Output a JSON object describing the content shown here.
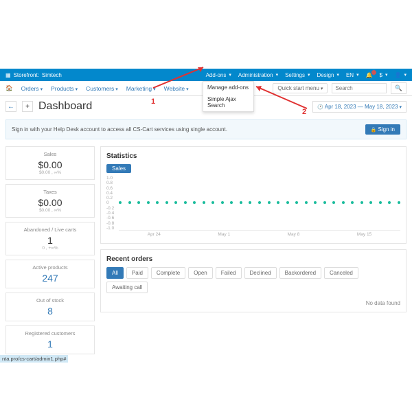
{
  "topbar": {
    "storefront_label": "Storefront:",
    "storefront_name": "Simtech",
    "menu": {
      "addons": "Add-ons",
      "administration": "Administration",
      "settings": "Settings",
      "design": "Design",
      "lang": "EN",
      "currency": "$"
    }
  },
  "nav": {
    "orders": "Orders",
    "products": "Products",
    "customers": "Customers",
    "marketing": "Marketing",
    "website": "Website",
    "quickstart": "Quick start menu",
    "search_placeholder": "Search"
  },
  "dropdown": {
    "manage": "Manage add-ons",
    "ajax": "Simple Ajax Search"
  },
  "page": {
    "title": "Dashboard",
    "date_range": "Apr 18, 2023 — May 18, 2023",
    "notice": "Sign in with your Help Desk account to access all CS-Cart services using single account.",
    "signin": "Sign in"
  },
  "annotations": {
    "a1": "1",
    "a2": "2"
  },
  "stats": [
    {
      "label": "Sales",
      "value": "$0.00",
      "sub": "$0.00 , ∞%",
      "blue": false
    },
    {
      "label": "Taxes",
      "value": "$0.00",
      "sub": "$0.00 , ∞%",
      "blue": false
    },
    {
      "label": "Abandoned / Live carts",
      "value": "1",
      "sub": "0 , +∞%",
      "blue": false
    },
    {
      "label": "Active products",
      "value": "247",
      "sub": "",
      "blue": true
    },
    {
      "label": "Out of stock",
      "value": "8",
      "sub": "",
      "blue": true
    },
    {
      "label": "Registered customers",
      "value": "1",
      "sub": "",
      "blue": true
    }
  ],
  "statistics": {
    "title": "Statistics",
    "tab": "Sales"
  },
  "chart_data": {
    "type": "line",
    "title": "Sales",
    "ylim": [
      -1.0,
      1.0
    ],
    "yticks": [
      "1.0",
      "0.8",
      "0.6",
      "0.4",
      "0.2",
      "0",
      "-0.2",
      "-0.4",
      "-0.6",
      "-0.8",
      "-1.0"
    ],
    "xticks": [
      "Apr 24",
      "May 1",
      "May 8",
      "May 15"
    ],
    "series": [
      {
        "name": "Sales",
        "values": [
          0,
          0,
          0,
          0,
          0,
          0,
          0,
          0,
          0,
          0,
          0,
          0,
          0,
          0,
          0,
          0,
          0,
          0,
          0,
          0,
          0,
          0,
          0,
          0,
          0,
          0,
          0,
          0,
          0,
          0,
          0
        ]
      }
    ]
  },
  "recent": {
    "title": "Recent orders",
    "filters": [
      "All",
      "Paid",
      "Complete",
      "Open",
      "Failed",
      "Declined",
      "Backordered",
      "Canceled",
      "Awaiting call"
    ],
    "active": 0,
    "nodata": "No data found"
  },
  "url_hint": "nta.pro/cs-cart/admin1.php#"
}
